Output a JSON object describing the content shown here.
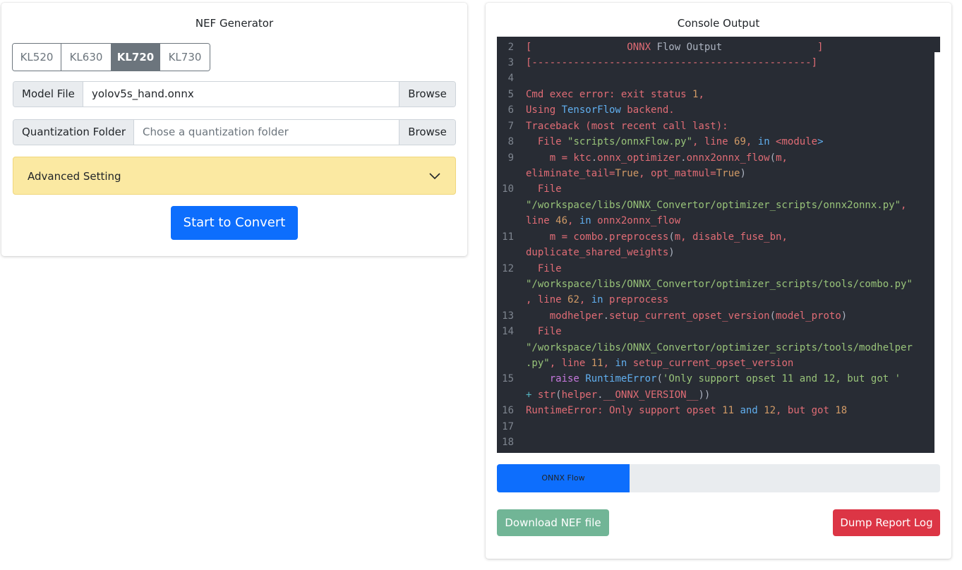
{
  "left_panel": {
    "title": "NEF Generator",
    "chips": [
      {
        "label": "KL520",
        "active": false
      },
      {
        "label": "KL630",
        "active": false
      },
      {
        "label": "KL720",
        "active": true
      },
      {
        "label": "KL730",
        "active": false
      }
    ],
    "model_file": {
      "label": "Model File",
      "value": "yolov5s_hand.onnx",
      "button": "Browse"
    },
    "quantization_folder": {
      "label": "Quantization Folder",
      "placeholder": "Chose a quantization folder",
      "button": "Browse"
    },
    "advanced_setting": {
      "label": "Advanced Setting",
      "icon": "chevron-down-icon"
    },
    "convert_button": "Start to Convert"
  },
  "right_panel": {
    "title": "Console Output",
    "console_lines": [
      {
        "n": "2",
        "text": "[                ONNX Flow Output                ]"
      },
      {
        "n": "3",
        "text": "[-----------------------------------------------]"
      },
      {
        "n": "4",
        "text": ""
      },
      {
        "n": "5",
        "text": "Cmd exec error: exit status 1,"
      },
      {
        "n": "6",
        "text": "Using TensorFlow backend."
      },
      {
        "n": "7",
        "text": "Traceback (most recent call last):"
      },
      {
        "n": "8",
        "text": "  File \"scripts/onnxFlow.py\", line 69, in <module>"
      },
      {
        "n": "9",
        "text": "    m = ktc.onnx_optimizer.onnx2onnx_flow(m, eliminate_tail=True, opt_matmul=True)"
      },
      {
        "n": "10",
        "text": "  File \"/workspace/libs/ONNX_Convertor/optimizer_scripts/onnx2onnx.py\", line 46, in onnx2onnx_flow"
      },
      {
        "n": "11",
        "text": "    m = combo.preprocess(m, disable_fuse_bn, duplicate_shared_weights)"
      },
      {
        "n": "12",
        "text": "  File \"/workspace/libs/ONNX_Convertor/optimizer_scripts/tools/combo.py\", line 62, in preprocess"
      },
      {
        "n": "13",
        "text": "    modhelper.setup_current_opset_version(model_proto)"
      },
      {
        "n": "14",
        "text": "  File \"/workspace/libs/ONNX_Convertor/optimizer_scripts/tools/modhelper.py\", line 11, in setup_current_opset_version"
      },
      {
        "n": "15",
        "text": "    raise RuntimeError('Only support opset 11 and 12, but got ' + str(helper.__ONNX_VERSION__))"
      },
      {
        "n": "16",
        "text": "RuntimeError: Only support opset 11 and 12, but got 18"
      },
      {
        "n": "17",
        "text": ""
      },
      {
        "n": "18",
        "text": ""
      }
    ],
    "progress": {
      "label": "ONNX Flow",
      "fraction": 0.3,
      "color": "#0d6efd"
    },
    "download_button": "Download NEF file",
    "dump_button": "Dump Report Log"
  },
  "colors": {
    "primary": "#0d6efd",
    "success_disabled": "#71b596",
    "danger": "#dc3545",
    "warning_light": "#fbe9a2",
    "console_bg": "#282c34"
  }
}
